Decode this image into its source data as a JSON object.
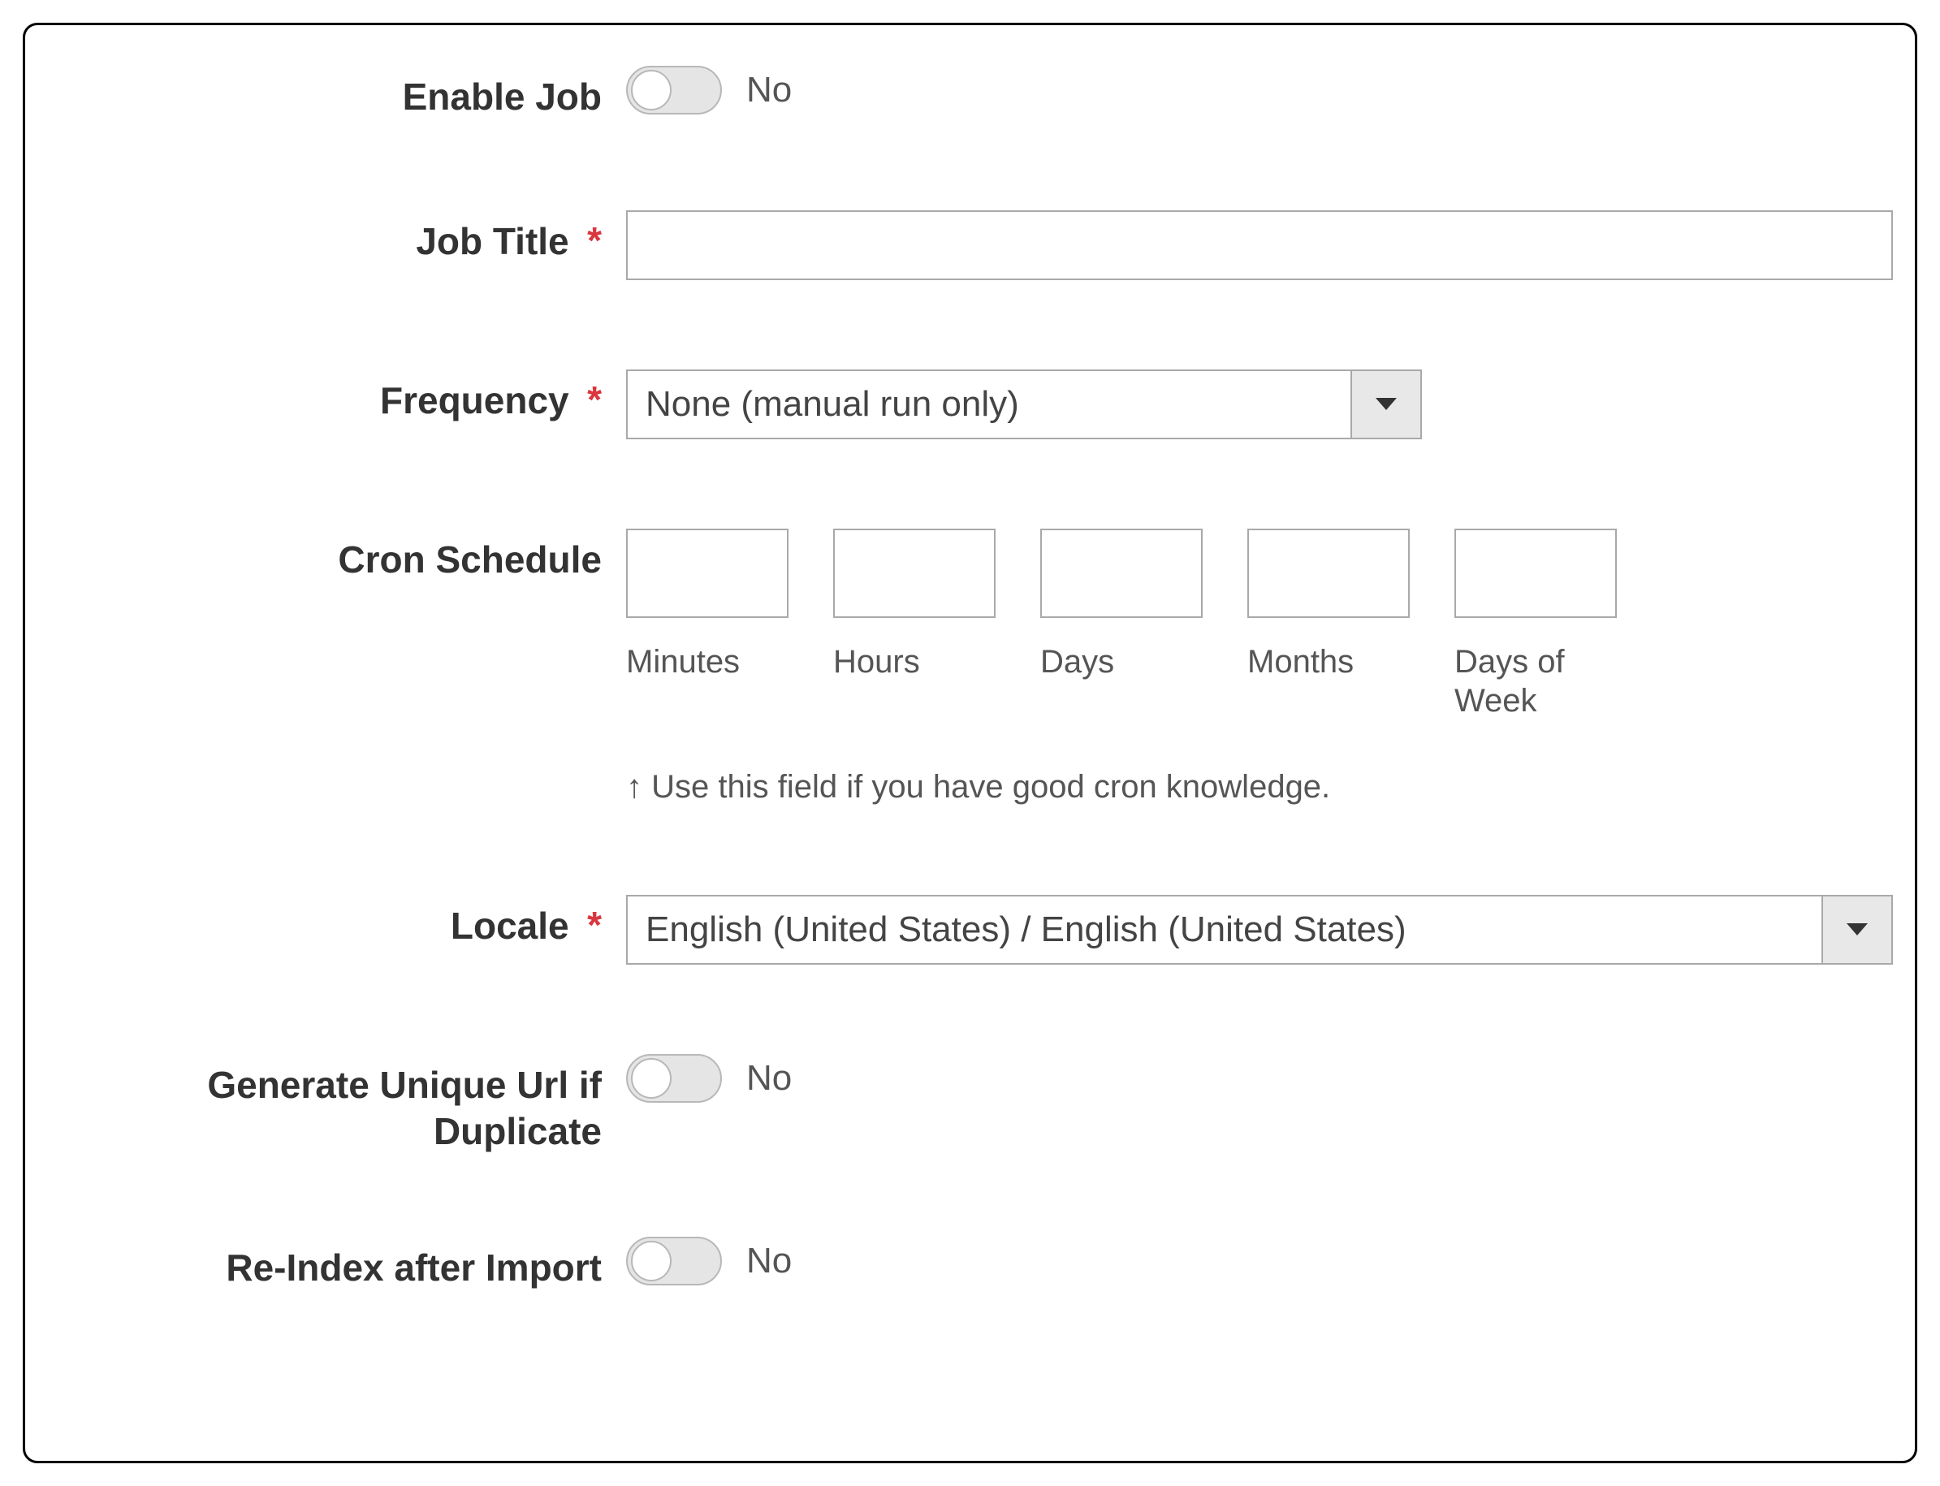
{
  "form": {
    "enable_job": {
      "label": "Enable Job",
      "state": "No"
    },
    "job_title": {
      "label": "Job Title",
      "value": ""
    },
    "frequency": {
      "label": "Frequency",
      "selected": "None (manual run only)"
    },
    "cron": {
      "label": "Cron Schedule",
      "hint": "↑ Use this field if you have good cron knowledge.",
      "fields": {
        "minutes": {
          "caption": "Minutes",
          "value": ""
        },
        "hours": {
          "caption": "Hours",
          "value": ""
        },
        "days": {
          "caption": "Days",
          "value": ""
        },
        "months": {
          "caption": "Months",
          "value": ""
        },
        "days_of_week": {
          "caption": "Days of Week",
          "value": ""
        }
      }
    },
    "locale": {
      "label": "Locale",
      "selected": "English (United States) / English (United States)"
    },
    "unique_url": {
      "label": "Generate Unique Url if Duplicate",
      "state": "No"
    },
    "reindex": {
      "label": "Re-Index after Import",
      "state": "No"
    }
  },
  "required_glyph": "*"
}
